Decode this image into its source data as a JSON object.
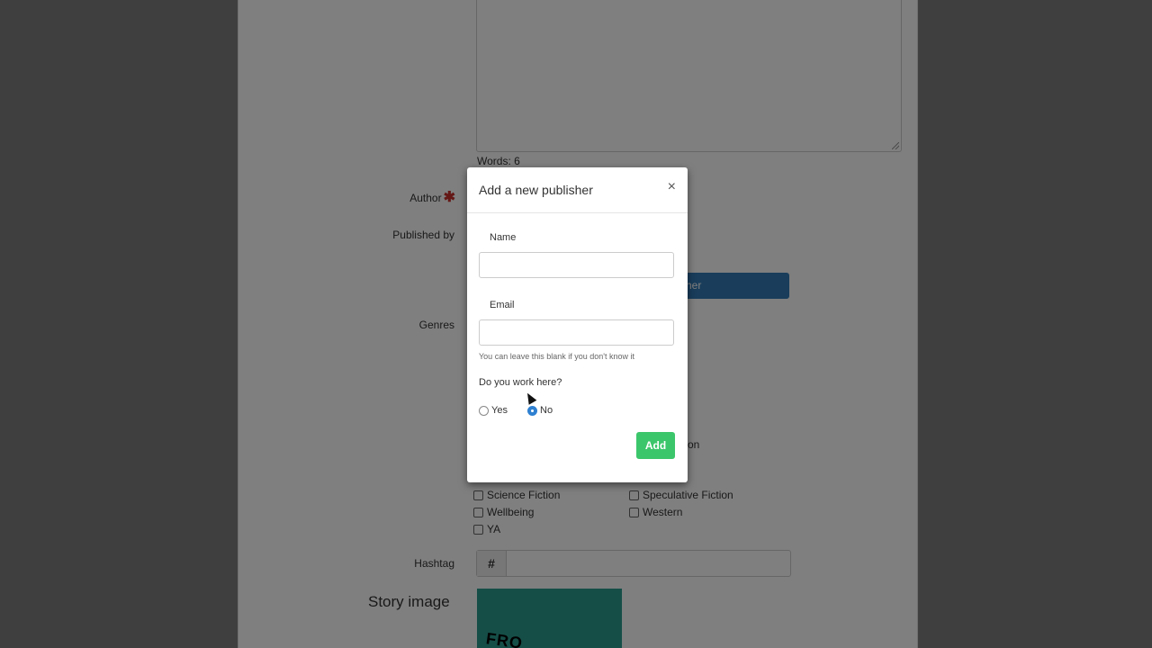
{
  "form": {
    "word_count": "Words: 6",
    "author_label": "Author",
    "author_required_mark": "✱",
    "published_by_label": "Published by",
    "add_publisher_button_peek": "her",
    "genres_label": "Genres",
    "genre_peek_text": "on",
    "genres": [
      "Science Fiction",
      "Speculative Fiction",
      "Wellbeing",
      "Western",
      "YA"
    ],
    "hashtag_label": "Hashtag",
    "hashtag_prefix": "#",
    "story_image_label": "Story image",
    "story_image_text": "FRO"
  },
  "modal": {
    "title": "Add a new publisher",
    "close_symbol": "×",
    "name_label": "Name",
    "name_value": "",
    "email_label": "Email",
    "email_value": "",
    "email_help": "You can leave this blank if you don't know it",
    "question": "Do you work here?",
    "option_yes": "Yes",
    "option_no": "No",
    "selected": "No",
    "add_label": "Add"
  },
  "colors": {
    "primary_button": "#337ab7",
    "add_button": "#3cc66b",
    "required_mark": "#c9302c"
  }
}
